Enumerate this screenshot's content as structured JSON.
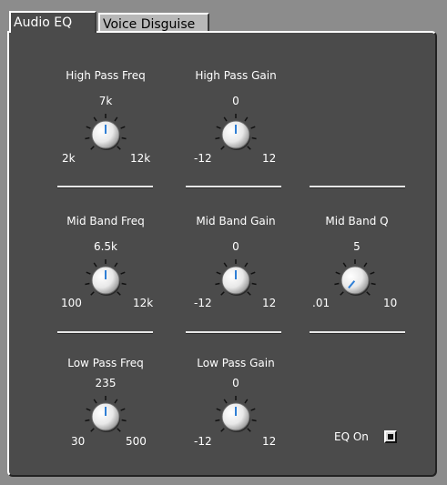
{
  "tabs": [
    {
      "label": "Audio EQ",
      "active": true
    },
    {
      "label": "Voice Disguise",
      "active": false
    }
  ],
  "knobs": {
    "high_pass_freq": {
      "title": "High Pass Freq",
      "value": "7k",
      "min": "2k",
      "max": "12k"
    },
    "high_pass_gain": {
      "title": "High Pass Gain",
      "value": "0",
      "min": "-12",
      "max": "12"
    },
    "mid_band_freq": {
      "title": "Mid Band Freq",
      "value": "6.5k",
      "min": "100",
      "max": "12k"
    },
    "mid_band_gain": {
      "title": "Mid Band Gain",
      "value": "0",
      "min": "-12",
      "max": "12"
    },
    "mid_band_q": {
      "title": "Mid Band Q",
      "value": "5",
      "min": ".01",
      "max": "10"
    },
    "low_pass_freq": {
      "title": "Low Pass Freq",
      "value": "235",
      "min": "30",
      "max": "500"
    },
    "low_pass_gain": {
      "title": "Low Pass Gain",
      "value": "0",
      "min": "-12",
      "max": "12"
    }
  },
  "eq_on": {
    "label": "EQ On",
    "checked": true
  },
  "colors": {
    "panel": "#4b4b4b",
    "indicator": "#2f7fd6",
    "knob": "#e8e8e8"
  }
}
